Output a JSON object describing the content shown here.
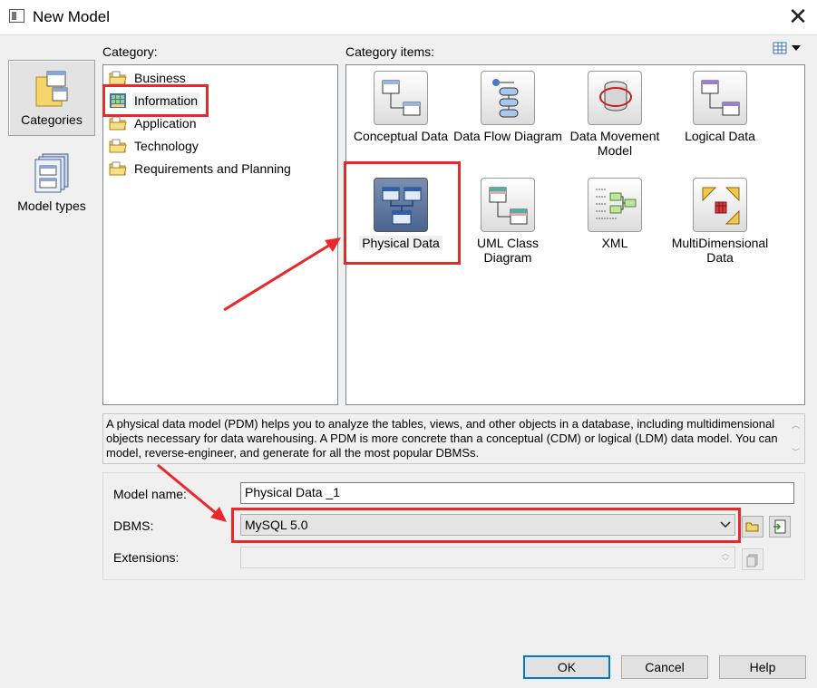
{
  "window": {
    "title": "New Model",
    "close_glyph": "✕"
  },
  "views": [
    {
      "label": "Categories",
      "icon": "categories-icon",
      "selected": true
    },
    {
      "label": "Model types",
      "icon": "model-types-icon",
      "selected": false
    }
  ],
  "category_label": "Category:",
  "items_label": "Category items:",
  "categories": [
    {
      "label": "Business",
      "icon": "folder-icon",
      "selected": false
    },
    {
      "label": "Information",
      "icon": "information-folder-icon",
      "selected": true
    },
    {
      "label": "Application",
      "icon": "folder-icon",
      "selected": false
    },
    {
      "label": "Technology",
      "icon": "folder-icon",
      "selected": false
    },
    {
      "label": "Requirements and Planning",
      "icon": "folder-icon",
      "selected": false
    }
  ],
  "items": [
    {
      "label": "Conceptual Data",
      "icon": "conceptual-data-icon",
      "selected": false
    },
    {
      "label": "Data Flow Diagram",
      "icon": "data-flow-icon",
      "selected": false
    },
    {
      "label": "Data Movement Model",
      "icon": "data-movement-icon",
      "selected": false
    },
    {
      "label": "Logical Data",
      "icon": "logical-data-icon",
      "selected": false
    },
    {
      "label": "Physical Data",
      "icon": "physical-data-icon",
      "selected": true
    },
    {
      "label": "UML Class Diagram",
      "icon": "uml-class-icon",
      "selected": false
    },
    {
      "label": "XML",
      "icon": "xml-icon",
      "selected": false
    },
    {
      "label": "MultiDimensional Data",
      "icon": "multidimensional-icon",
      "selected": false
    }
  ],
  "description": "A physical data model (PDM) helps you to analyze the tables, views, and other objects in a database, including multidimensional objects necessary for data warehousing. A PDM is more concrete than a conceptual (CDM) or logical (LDM) data model. You can model, reverse-engineer, and generate for all the most popular DBMSs.",
  "form": {
    "model_name_label": "Model name:",
    "model_name_value": "Physical Data _1",
    "dbms_label": "DBMS:",
    "dbms_value": "MySQL 5.0",
    "extensions_label": "Extensions:",
    "extensions_value": ""
  },
  "buttons": {
    "ok": "OK",
    "cancel": "Cancel",
    "help": "Help"
  },
  "colors": {
    "annotation_red": "#e8282a",
    "focus_blue": "#0078d7"
  }
}
